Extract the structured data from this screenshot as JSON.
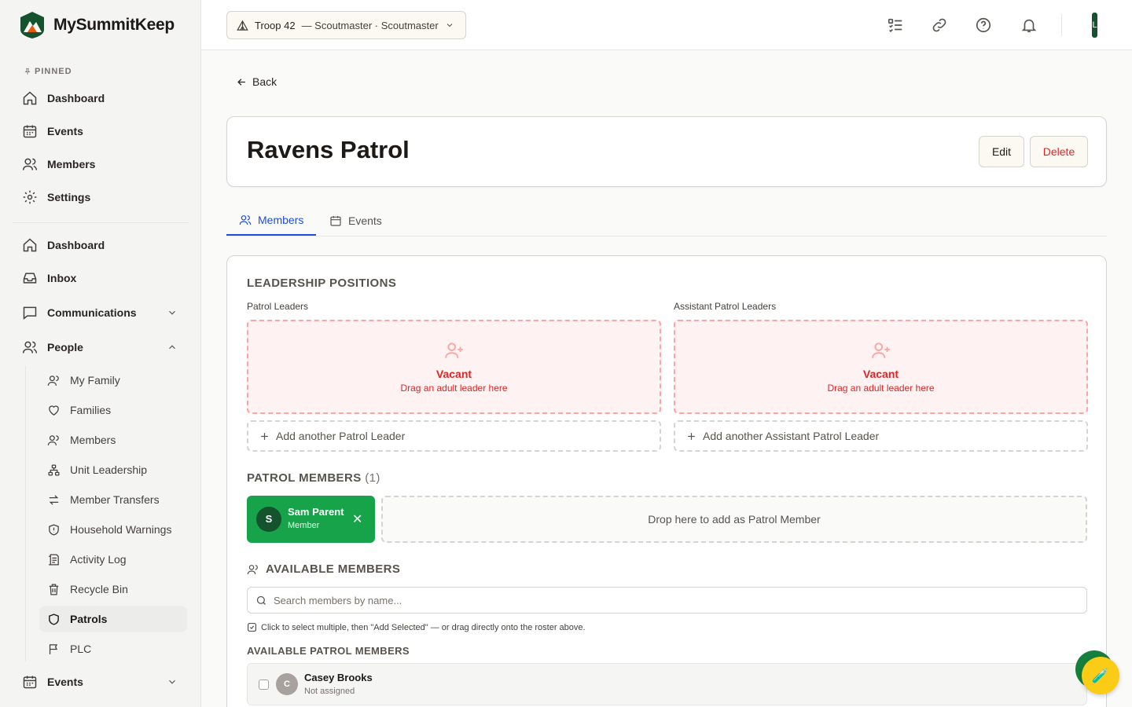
{
  "app": {
    "name": "MySummitKeep"
  },
  "sidebar": {
    "pinned_label": "PINNED",
    "pinned": [
      {
        "label": "Dashboard",
        "icon": "home-icon"
      },
      {
        "label": "Events",
        "icon": "calendar-icon"
      },
      {
        "label": "Members",
        "icon": "users-icon"
      },
      {
        "label": "Settings",
        "icon": "gear-icon"
      }
    ],
    "main": [
      {
        "label": "Dashboard",
        "icon": "home-icon"
      },
      {
        "label": "Inbox",
        "icon": "inbox-icon"
      },
      {
        "label": "Communications",
        "icon": "message-icon",
        "expanded": false
      },
      {
        "label": "People",
        "icon": "users-icon",
        "expanded": true
      }
    ],
    "people_sub": [
      {
        "label": "My Family",
        "icon": "user-group-icon"
      },
      {
        "label": "Families",
        "icon": "heart-icon"
      },
      {
        "label": "Members",
        "icon": "users-icon"
      },
      {
        "label": "Unit Leadership",
        "icon": "org-chart-icon"
      },
      {
        "label": "Member Transfers",
        "icon": "transfer-icon"
      },
      {
        "label": "Household Warnings",
        "icon": "shield-alert-icon"
      },
      {
        "label": "Activity Log",
        "icon": "log-icon"
      },
      {
        "label": "Recycle Bin",
        "icon": "trash-icon"
      },
      {
        "label": "Patrols",
        "icon": "shield-icon",
        "active": true
      },
      {
        "label": "PLC",
        "icon": "flag-icon"
      }
    ],
    "events_group": {
      "label": "Events",
      "icon": "calendar-icon",
      "expanded": false
    }
  },
  "header": {
    "troop": "Troop 42",
    "role_text": "— Scoutmaster · Scoutmaster",
    "avatar_initial": "L",
    "icons": [
      "checklist-icon",
      "link-icon",
      "help-icon",
      "bell-icon"
    ]
  },
  "page": {
    "back_label": "Back",
    "title": "Ravens Patrol",
    "edit_label": "Edit",
    "delete_label": "Delete",
    "tabs": [
      {
        "label": "Members",
        "active": true
      },
      {
        "label": "Events",
        "active": false
      }
    ]
  },
  "leadership": {
    "title": "LEADERSHIP POSITIONS",
    "patrol_leaders": {
      "label": "Patrol Leaders",
      "vacant": "Vacant",
      "hint": "Drag an adult leader here",
      "add": "Add another Patrol Leader"
    },
    "assistant_leaders": {
      "label": "Assistant Patrol Leaders",
      "vacant": "Vacant",
      "hint": "Drag an adult leader here",
      "add": "Add another Assistant Patrol Leader"
    }
  },
  "patrol_members": {
    "title": "PATROL MEMBERS",
    "count": "(1)",
    "members": [
      {
        "initial": "S",
        "name": "Sam Parent",
        "role": "Member"
      }
    ],
    "drop_hint": "Drop here to add as Patrol Member"
  },
  "available": {
    "title": "AVAILABLE MEMBERS",
    "search_placeholder": "Search members by name...",
    "hint": "Click to select multiple, then \"Add Selected\" — or drag directly onto the roster above.",
    "subtitle": "AVAILABLE PATROL MEMBERS",
    "rows": [
      {
        "initial": "C",
        "name": "Casey Brooks",
        "status": "Not assigned"
      }
    ]
  },
  "colors": {
    "accent_blue": "#1d4ed8",
    "danger": "#dc2626",
    "member_green": "#16a34a",
    "brand_dark_green": "#14532d",
    "fab_yellow": "#facc15"
  }
}
